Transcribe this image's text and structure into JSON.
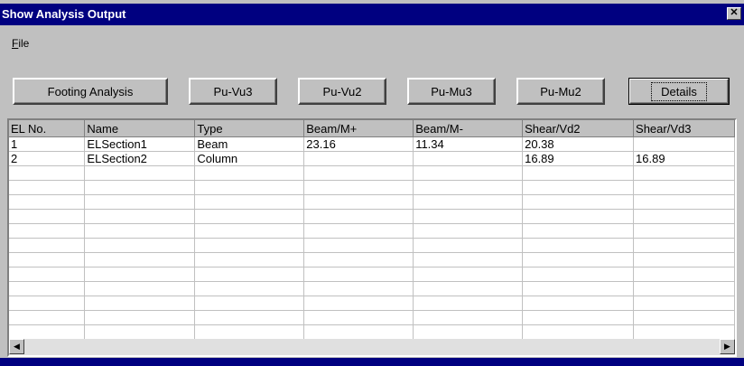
{
  "window": {
    "title": "Show Analysis Output",
    "close_label": "✕"
  },
  "menu": {
    "file_label_underlined": "F",
    "file_label_rest": "ile"
  },
  "buttons": {
    "footing": "Footing Analysis",
    "puvu3": "Pu-Vu3",
    "puvu2": "Pu-Vu2",
    "pumu3": "Pu-Mu3",
    "pumu2": "Pu-Mu2",
    "details": "Details"
  },
  "table": {
    "columns": [
      "EL No.",
      "Name",
      "Type",
      "Beam/M+",
      "Beam/M-",
      "Shear/Vd2",
      "Shear/Vd3"
    ],
    "rows": [
      [
        "1",
        "ELSection1",
        "Beam",
        "23.16",
        "11.34",
        "20.38",
        ""
      ],
      [
        "2",
        "ELSection2",
        "Column",
        "",
        "",
        "16.89",
        "16.89"
      ],
      [
        "",
        "",
        "",
        "",
        "",
        "",
        ""
      ],
      [
        "",
        "",
        "",
        "",
        "",
        "",
        ""
      ],
      [
        "",
        "",
        "",
        "",
        "",
        "",
        ""
      ],
      [
        "",
        "",
        "",
        "",
        "",
        "",
        ""
      ],
      [
        "",
        "",
        "",
        "",
        "",
        "",
        ""
      ],
      [
        "",
        "",
        "",
        "",
        "",
        "",
        ""
      ],
      [
        "",
        "",
        "",
        "",
        "",
        "",
        ""
      ],
      [
        "",
        "",
        "",
        "",
        "",
        "",
        ""
      ],
      [
        "",
        "",
        "",
        "",
        "",
        "",
        ""
      ],
      [
        "",
        "",
        "",
        "",
        "",
        "",
        ""
      ],
      [
        "",
        "",
        "",
        "",
        "",
        "",
        ""
      ],
      [
        "",
        "",
        "",
        "",
        "",
        "",
        ""
      ]
    ]
  },
  "scrollbar": {
    "left_arrow": "◀",
    "right_arrow": "▶"
  }
}
